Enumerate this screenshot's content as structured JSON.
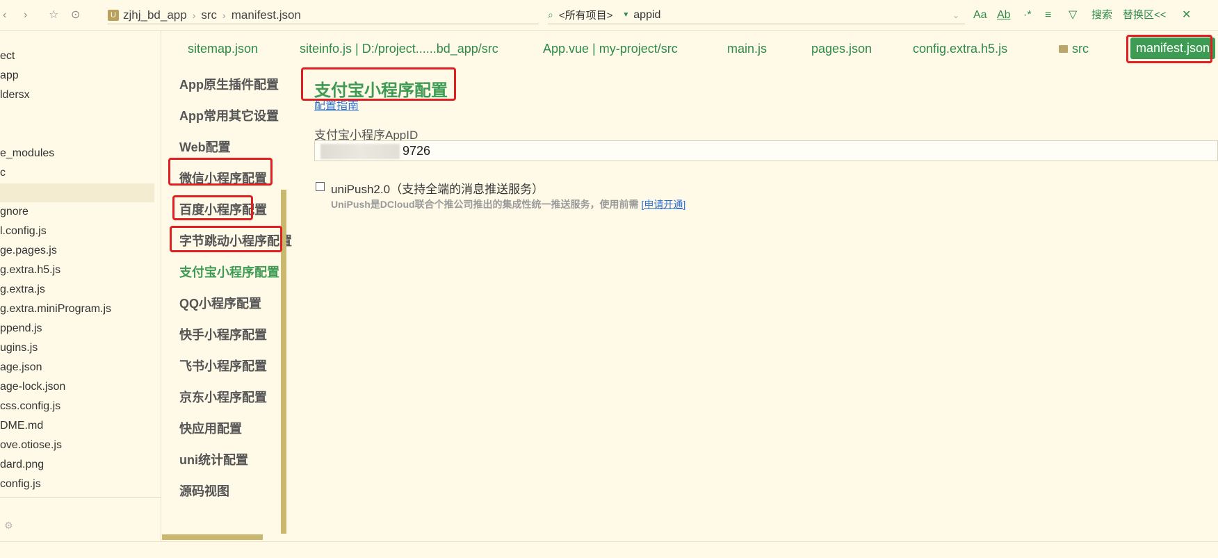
{
  "toolbar": {
    "breadcrumb": [
      "zjhj_bd_app",
      "src",
      "manifest.json"
    ],
    "search_scope": "<所有项目>",
    "search_query": "appid",
    "tools": [
      "Aa",
      "Ab",
      "·*",
      "≡",
      "▽",
      "搜索",
      "替换区<<",
      "✕"
    ]
  },
  "filetree": {
    "items": [
      "ect",
      "app",
      "ldersx",
      "e_modules",
      "c",
      "",
      "gnore",
      "l.config.js",
      "ge.pages.js",
      "g.extra.h5.js",
      "g.extra.js",
      "g.extra.miniProgram.js",
      "ppend.js",
      "ugins.js",
      "age.json",
      "age-lock.json",
      "css.config.js",
      "DME.md",
      "ove.otiose.js",
      "dard.png",
      "config.js"
    ]
  },
  "tabs": [
    "sitemap.json",
    "siteinfo.js | D:/project......bd_app/src",
    "App.vue | my-project/src",
    "main.js",
    "pages.json",
    "config.extra.h5.js",
    "src",
    "manifest.json"
  ],
  "confnav": [
    "App原生插件配置",
    "App常用其它设置",
    "Web配置",
    "微信小程序配置",
    "百度小程序配置",
    "字节跳动小程序配置",
    "支付宝小程序配置",
    "QQ小程序配置",
    "快手小程序配置",
    "飞书小程序配置",
    "京东小程序配置",
    "快应用配置",
    "uni统计配置",
    "源码视图"
  ],
  "main": {
    "title": "支付宝小程序配置",
    "guide_link": "配置指南",
    "appid_label": "支付宝小程序AppID",
    "appid_value": "9726",
    "unipush_label": "uniPush2.0（支持全端的消息推送服务）",
    "unipush_desc": "UniPush是DCloud联合个推公司推出的集成性统一推送服务，使用前需",
    "unipush_link": "[申请开通]"
  },
  "colors": {
    "accent": "#3d9b54",
    "background": "#fffae8",
    "highlight": "#e02020",
    "link": "#2a6fd6"
  }
}
